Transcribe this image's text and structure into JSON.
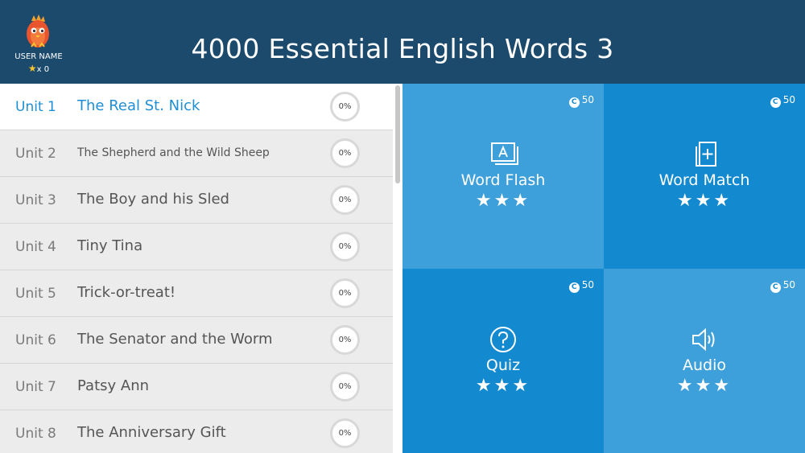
{
  "header": {
    "title": "4000 Essential English Words 3",
    "user_name": "USER NAME",
    "star_count": "x 0",
    "avatar_icon": "flame-egg-avatar"
  },
  "units": [
    {
      "unit": "Unit 1",
      "title": "The Real St. Nick",
      "progress": "0%",
      "selected": true
    },
    {
      "unit": "Unit 2",
      "title": "The Shepherd and the Wild Sheep",
      "progress": "0%"
    },
    {
      "unit": "Unit 3",
      "title": "The Boy and his Sled",
      "progress": "0%"
    },
    {
      "unit": "Unit 4",
      "title": "Tiny Tina",
      "progress": "0%"
    },
    {
      "unit": "Unit 5",
      "title": "Trick-or-treat!",
      "progress": "0%"
    },
    {
      "unit": "Unit 6",
      "title": "The Senator and the Worm",
      "progress": "0%"
    },
    {
      "unit": "Unit 7",
      "title": "Patsy Ann",
      "progress": "0%"
    },
    {
      "unit": "Unit 8",
      "title": "The Anniversary Gift",
      "progress": "0%"
    }
  ],
  "activities": [
    {
      "label": "Word Flash",
      "coins": "50",
      "stars": "★★★",
      "icon": "flashcard-icon"
    },
    {
      "label": "Word Match",
      "coins": "50",
      "stars": "★★★",
      "icon": "card-plus-icon"
    },
    {
      "label": "Quiz",
      "coins": "50",
      "stars": "★★★",
      "icon": "question-icon"
    },
    {
      "label": "Audio",
      "coins": "50",
      "stars": "★★★",
      "icon": "speaker-icon"
    }
  ],
  "colors": {
    "header_bg": "#1c4a6c",
    "accent": "#1e8fd4",
    "tile_light": "#3ea0db",
    "tile_dark": "#138ad0"
  }
}
